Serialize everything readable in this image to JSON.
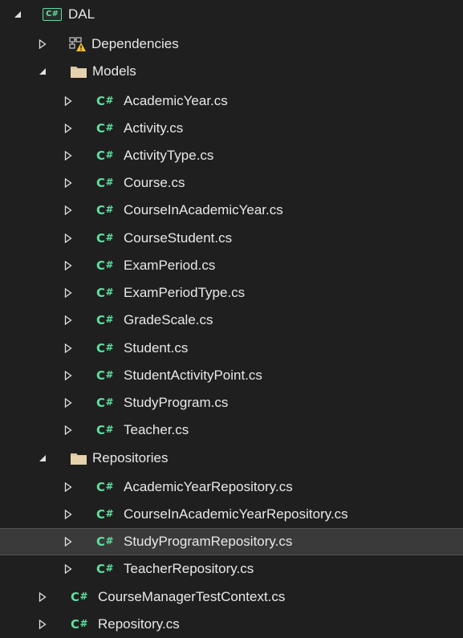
{
  "project": {
    "label": "DAL",
    "icon": "csharp-project-icon"
  },
  "dependencies": {
    "label": "Dependencies",
    "icon": "dependencies-warning-icon"
  },
  "models": {
    "label": "Models",
    "icon": "folder-icon",
    "files": [
      "AcademicYear.cs",
      "Activity.cs",
      "ActivityType.cs",
      "Course.cs",
      "CourseInAcademicYear.cs",
      "CourseStudent.cs",
      "ExamPeriod.cs",
      "ExamPeriodType.cs",
      "GradeScale.cs",
      "Student.cs",
      "StudentActivityPoint.cs",
      "StudyProgram.cs",
      "Teacher.cs"
    ]
  },
  "repositories": {
    "label": "Repositories",
    "icon": "folder-icon",
    "files": [
      "AcademicYearRepository.cs",
      "CourseInAcademicYearRepository.cs",
      "StudyProgramRepository.cs",
      "TeacherRepository.cs"
    ],
    "selected": "StudyProgramRepository.cs"
  },
  "root_files": [
    "CourseManagerTestContext.cs",
    "Repository.cs"
  ],
  "file_icon_text": "C#",
  "colors": {
    "background": "#1f1f1f",
    "selected_row": "#3a3a3a",
    "csharp_green": "#5ee0a0",
    "folder_tan": "#dcc7a1"
  }
}
